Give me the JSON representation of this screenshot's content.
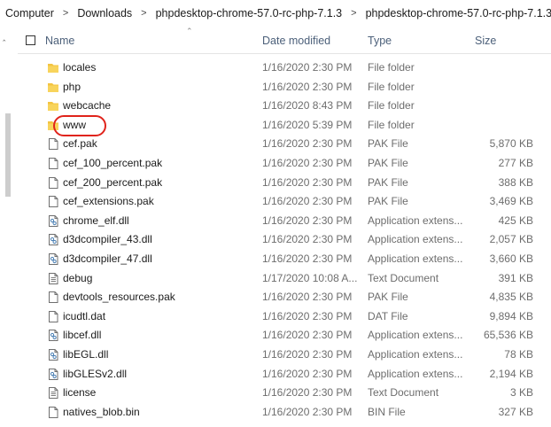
{
  "breadcrumb": [
    "Computer",
    "Downloads",
    "phpdesktop-chrome-57.0-rc-php-7.1.3",
    "phpdesktop-chrome-57.0-rc-php-7.1.3"
  ],
  "columns": {
    "name": "Name",
    "date": "Date modified",
    "type": "Type",
    "size": "Size"
  },
  "files": [
    {
      "name": "locales",
      "date": "1/16/2020 2:30 PM",
      "type": "File folder",
      "size": "",
      "icon": "folder-icon"
    },
    {
      "name": "php",
      "date": "1/16/2020 2:30 PM",
      "type": "File folder",
      "size": "",
      "icon": "folder-icon"
    },
    {
      "name": "webcache",
      "date": "1/16/2020 8:43 PM",
      "type": "File folder",
      "size": "",
      "icon": "folder-icon"
    },
    {
      "name": "www",
      "date": "1/16/2020 5:39 PM",
      "type": "File folder",
      "size": "",
      "icon": "folder-icon"
    },
    {
      "name": "cef.pak",
      "date": "1/16/2020 2:30 PM",
      "type": "PAK File",
      "size": "5,870 KB",
      "icon": "file-icon"
    },
    {
      "name": "cef_100_percent.pak",
      "date": "1/16/2020 2:30 PM",
      "type": "PAK File",
      "size": "277 KB",
      "icon": "file-icon"
    },
    {
      "name": "cef_200_percent.pak",
      "date": "1/16/2020 2:30 PM",
      "type": "PAK File",
      "size": "388 KB",
      "icon": "file-icon"
    },
    {
      "name": "cef_extensions.pak",
      "date": "1/16/2020 2:30 PM",
      "type": "PAK File",
      "size": "3,469 KB",
      "icon": "file-icon"
    },
    {
      "name": "chrome_elf.dll",
      "date": "1/16/2020 2:30 PM",
      "type": "Application extens...",
      "size": "425 KB",
      "icon": "dll-icon"
    },
    {
      "name": "d3dcompiler_43.dll",
      "date": "1/16/2020 2:30 PM",
      "type": "Application extens...",
      "size": "2,057 KB",
      "icon": "dll-icon"
    },
    {
      "name": "d3dcompiler_47.dll",
      "date": "1/16/2020 2:30 PM",
      "type": "Application extens...",
      "size": "3,660 KB",
      "icon": "dll-icon"
    },
    {
      "name": "debug",
      "date": "1/17/2020 10:08 A...",
      "type": "Text Document",
      "size": "391 KB",
      "icon": "text-file-icon"
    },
    {
      "name": "devtools_resources.pak",
      "date": "1/16/2020 2:30 PM",
      "type": "PAK File",
      "size": "4,835 KB",
      "icon": "file-icon"
    },
    {
      "name": "icudtl.dat",
      "date": "1/16/2020 2:30 PM",
      "type": "DAT File",
      "size": "9,894 KB",
      "icon": "file-icon"
    },
    {
      "name": "libcef.dll",
      "date": "1/16/2020 2:30 PM",
      "type": "Application extens...",
      "size": "65,536 KB",
      "icon": "dll-icon"
    },
    {
      "name": "libEGL.dll",
      "date": "1/16/2020 2:30 PM",
      "type": "Application extens...",
      "size": "78 KB",
      "icon": "dll-icon"
    },
    {
      "name": "libGLESv2.dll",
      "date": "1/16/2020 2:30 PM",
      "type": "Application extens...",
      "size": "2,194 KB",
      "icon": "dll-icon"
    },
    {
      "name": "license",
      "date": "1/16/2020 2:30 PM",
      "type": "Text Document",
      "size": "3 KB",
      "icon": "text-file-icon"
    },
    {
      "name": "natives_blob.bin",
      "date": "1/16/2020 2:30 PM",
      "type": "BIN File",
      "size": "327 KB",
      "icon": "file-icon"
    }
  ],
  "colors": {
    "folder": "#f3c441",
    "header_text": "#4c607a",
    "secondary_text": "#6d6d6d",
    "highlight_oval": "#e0231b"
  }
}
